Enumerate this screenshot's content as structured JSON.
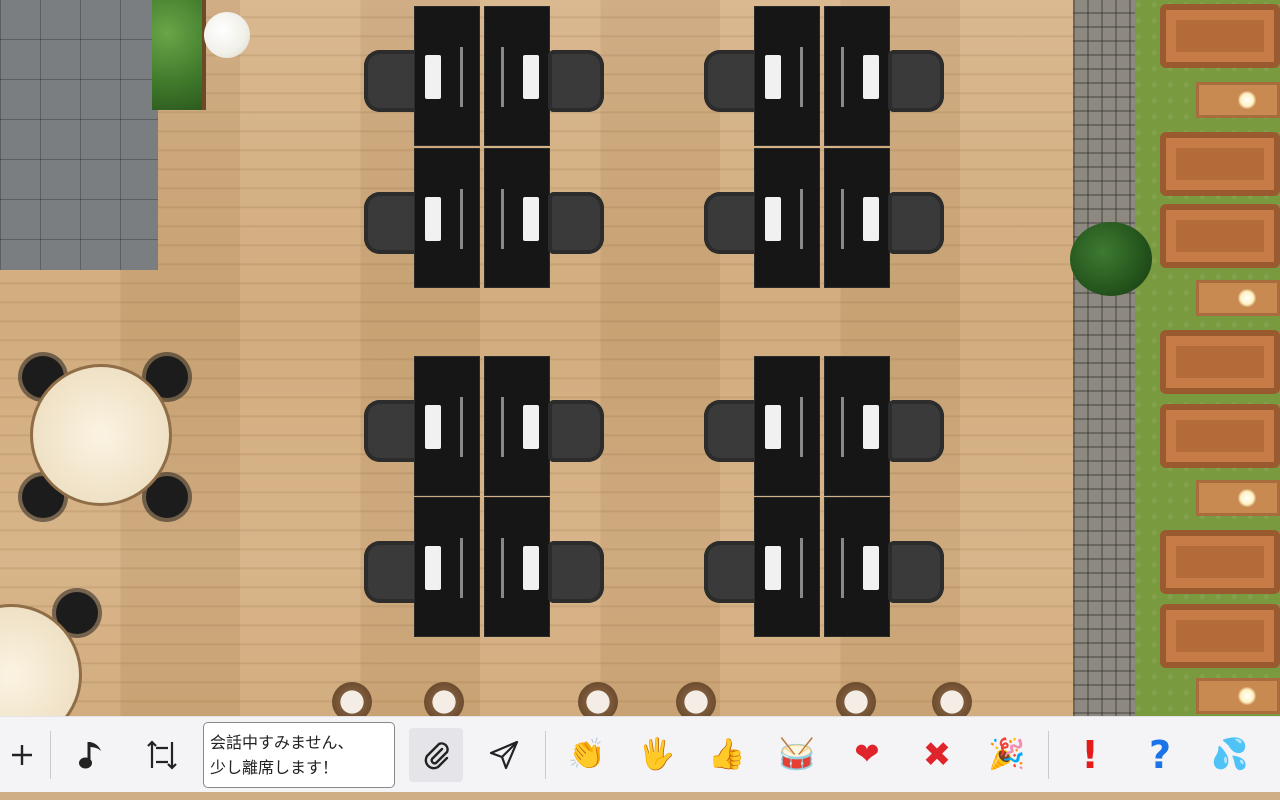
{
  "toolbar": {
    "add_icon": "plus-icon",
    "music_icon": "music-note-icon",
    "swap_icon": "swap-layout-icon",
    "message_text": "会話中すみません、\n少し離席します！",
    "attach_icon": "paperclip-icon",
    "send_icon": "send-icon",
    "reactions": [
      {
        "name": "clap",
        "glyph": "👏"
      },
      {
        "name": "raised-hand",
        "glyph": "🖐"
      },
      {
        "name": "thumbs-up",
        "glyph": "👍"
      },
      {
        "name": "drum",
        "glyph": "🥁"
      },
      {
        "name": "heart",
        "glyph": "❤"
      },
      {
        "name": "cross",
        "glyph": "✖"
      },
      {
        "name": "party-popper",
        "glyph": "🎉"
      }
    ],
    "status_marks": [
      {
        "name": "exclamation",
        "glyph": "!"
      },
      {
        "name": "question",
        "glyph": "?"
      },
      {
        "name": "sweat",
        "glyph": "💦"
      }
    ]
  },
  "colors": {
    "toolbar_bg": "#f4f4f7",
    "exclamation": "#e41b1b",
    "question": "#1a73e8",
    "heart": "#e0242b"
  }
}
